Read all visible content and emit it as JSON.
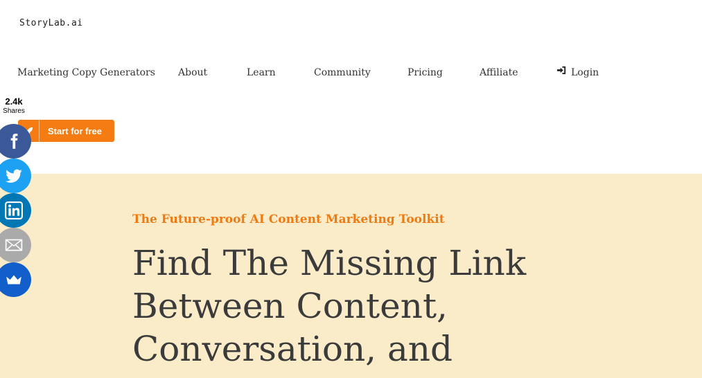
{
  "brand": {
    "logo_text": "StoryLab.ai"
  },
  "nav": {
    "items": [
      {
        "label": "Marketing Copy Generators"
      },
      {
        "label": "About"
      },
      {
        "label": "Learn"
      },
      {
        "label": "Community"
      },
      {
        "label": "Pricing"
      },
      {
        "label": "Affiliate"
      }
    ],
    "login": {
      "label": "Login",
      "icon": "sign-in-icon"
    }
  },
  "cta": {
    "label": "Start for free",
    "icon": "rocket-icon",
    "color": "#f57c12"
  },
  "share_bar": {
    "count": "2.4k",
    "label": "Shares",
    "buttons": [
      {
        "network": "facebook",
        "icon": "facebook-icon",
        "color": "#3b5998"
      },
      {
        "network": "twitter",
        "icon": "twitter-icon",
        "color": "#1da1f2"
      },
      {
        "network": "linkedin",
        "icon": "linkedin-icon",
        "color": "#0077b5"
      },
      {
        "network": "email",
        "icon": "email-icon",
        "color": "#aaaaaa"
      },
      {
        "network": "sumome",
        "icon": "crown-icon",
        "color": "#125ecb"
      }
    ]
  },
  "hero": {
    "background": "#fbecc9",
    "eyebrow": "The Future-proof AI Content Marketing Toolkit",
    "headline_lines": [
      "Find The Missing Link",
      "Between Content,",
      "Conversation, and"
    ]
  }
}
